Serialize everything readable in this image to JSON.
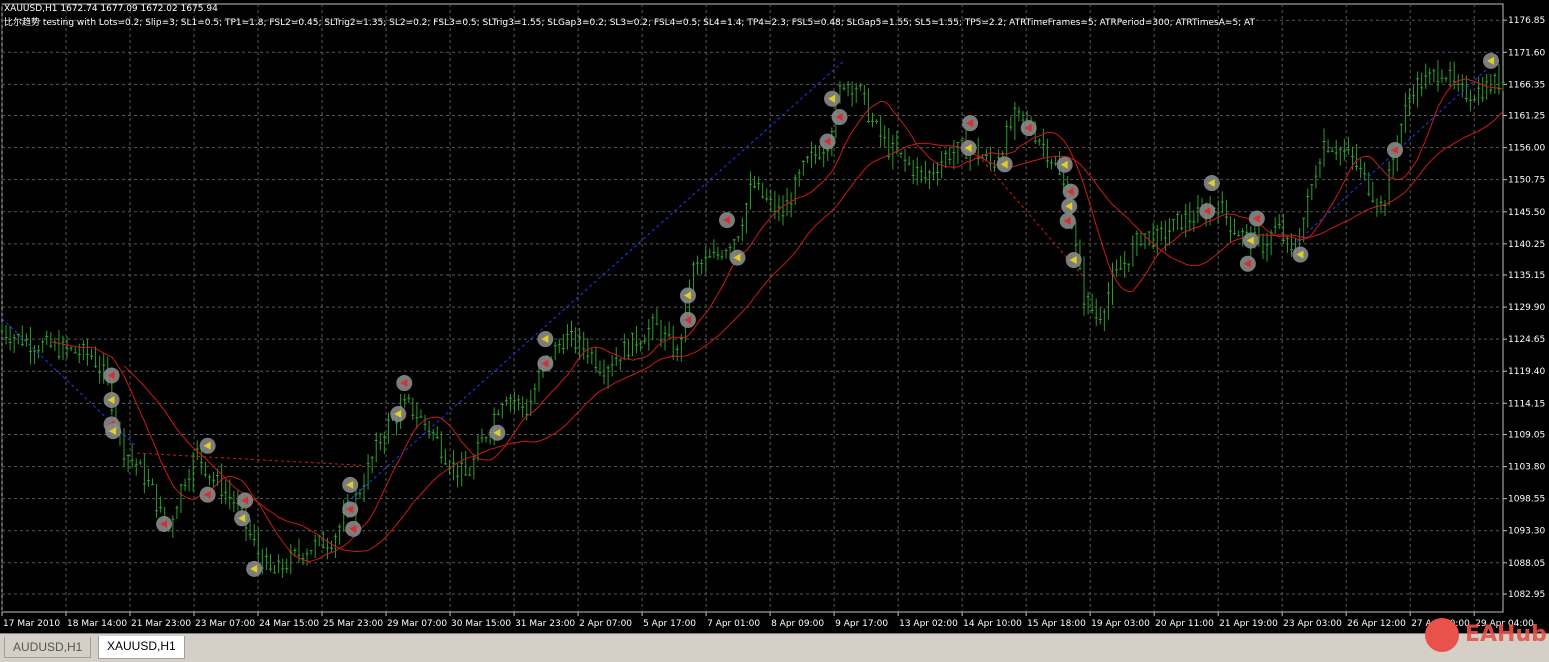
{
  "header": {
    "symbol_line": "XAUUSD,H1  1672.74 1677.09 1672.02 1675.94",
    "params_line": "比尔趋势 testing with Lots=0.2; Slip=3; SL1=0.5; TP1=1.8; FSL2=0.45; SLTrig2=1.35; SL2=0.2; FSL3=0.5; SLTrig3=1.55; SLGap3=0.2; SL3=0.2; FSL4=0.5; SL4=1.4; TP4=2.3; FSL5=0.48; SLGap5=1.55; SL5=1.55; TP5=2.2; ATRTimeFrames=5; ATRPeriod=300; ATRTimesA=5; AT"
  },
  "tabs": [
    "AUDUSD,H1",
    "XAUUSD,H1"
  ],
  "active_tab": 1,
  "watermark": "EAHub",
  "colors": {
    "background": "#000000",
    "grid": "#5a5a5a",
    "candle": "#2e9d2e",
    "ma": "#cc1a1a",
    "signal_blue": "#1a3cff",
    "axis_text": "#ffffff"
  },
  "chart_data": {
    "type": "candlestick",
    "ylim": [
      1080.0,
      1179.5
    ],
    "y_ticks": [
      "1176.85",
      "1171.60",
      "1166.35",
      "1161.25",
      "1156.00",
      "1150.75",
      "1145.50",
      "1140.25",
      "1135.15",
      "1129.90",
      "1124.65",
      "1119.40",
      "1114.15",
      "1109.05",
      "1103.80",
      "1098.55",
      "1093.30",
      "1088.05",
      "1082.95"
    ],
    "x_ticks": [
      "17 Mar 2010",
      "18 Mar 14:00",
      "21 Mar 23:00",
      "23 Mar 07:00",
      "24 Mar 15:00",
      "25 Mar 23:00",
      "29 Mar 07:00",
      "30 Mar 15:00",
      "31 Mar 23:00",
      "2 Apr 07:00",
      "5 Apr 17:00",
      "7 Apr 01:00",
      "8 Apr 09:00",
      "9 Apr 17:00",
      "13 Apr 02:00",
      "14 Apr 10:00",
      "15 Apr 18:00",
      "19 Apr 03:00",
      "20 Apr 11:00",
      "21 Apr 19:00",
      "23 Apr 03:00",
      "26 Apr 12:00",
      "27 Apr 20:00",
      "29 Apr 04:00"
    ],
    "close_path": [
      [
        0,
        1126
      ],
      [
        0.02,
        1124
      ],
      [
        0.04,
        1123
      ],
      [
        0.06,
        1122
      ],
      [
        0.07,
        1118
      ],
      [
        0.08,
        1107
      ],
      [
        0.09,
        1104
      ],
      [
        0.1,
        1100
      ],
      [
        0.11,
        1093
      ],
      [
        0.12,
        1101
      ],
      [
        0.13,
        1106
      ],
      [
        0.14,
        1102
      ],
      [
        0.155,
        1098
      ],
      [
        0.17,
        1090
      ],
      [
        0.18,
        1086
      ],
      [
        0.2,
        1090
      ],
      [
        0.22,
        1092
      ],
      [
        0.235,
        1098
      ],
      [
        0.245,
        1104
      ],
      [
        0.255,
        1110
      ],
      [
        0.27,
        1114
      ],
      [
        0.285,
        1110
      ],
      [
        0.3,
        1104
      ],
      [
        0.31,
        1102
      ],
      [
        0.32,
        1108
      ],
      [
        0.335,
        1116
      ],
      [
        0.35,
        1113
      ],
      [
        0.36,
        1120
      ],
      [
        0.375,
        1125
      ],
      [
        0.39,
        1123
      ],
      [
        0.4,
        1120
      ],
      [
        0.42,
        1124
      ],
      [
        0.435,
        1127
      ],
      [
        0.45,
        1122
      ],
      [
        0.46,
        1136
      ],
      [
        0.475,
        1138
      ],
      [
        0.49,
        1142
      ],
      [
        0.5,
        1150
      ],
      [
        0.51,
        1147
      ],
      [
        0.52,
        1145
      ],
      [
        0.535,
        1153
      ],
      [
        0.55,
        1157
      ],
      [
        0.56,
        1167
      ],
      [
        0.57,
        1166
      ],
      [
        0.58,
        1160
      ],
      [
        0.59,
        1156
      ],
      [
        0.6,
        1154
      ],
      [
        0.615,
        1151
      ],
      [
        0.63,
        1155
      ],
      [
        0.645,
        1156
      ],
      [
        0.66,
        1153
      ],
      [
        0.675,
        1161
      ],
      [
        0.69,
        1158
      ],
      [
        0.7,
        1154
      ],
      [
        0.71,
        1148
      ],
      [
        0.72,
        1132
      ],
      [
        0.73,
        1128
      ],
      [
        0.74,
        1134
      ],
      [
        0.75,
        1138
      ],
      [
        0.76,
        1142
      ],
      [
        0.77,
        1141
      ],
      [
        0.785,
        1144
      ],
      [
        0.8,
        1145
      ],
      [
        0.81,
        1147
      ],
      [
        0.82,
        1143
      ],
      [
        0.83,
        1141
      ],
      [
        0.84,
        1140
      ],
      [
        0.85,
        1143
      ],
      [
        0.86,
        1138
      ],
      [
        0.87,
        1147
      ],
      [
        0.88,
        1157
      ],
      [
        0.89,
        1156
      ],
      [
        0.9,
        1154
      ],
      [
        0.91,
        1150
      ],
      [
        0.92,
        1146
      ],
      [
        0.93,
        1158
      ],
      [
        0.94,
        1166
      ],
      [
        0.95,
        1167
      ],
      [
        0.96,
        1169
      ],
      [
        0.97,
        1165
      ],
      [
        0.98,
        1165
      ],
      [
        1,
        1167
      ]
    ]
  }
}
